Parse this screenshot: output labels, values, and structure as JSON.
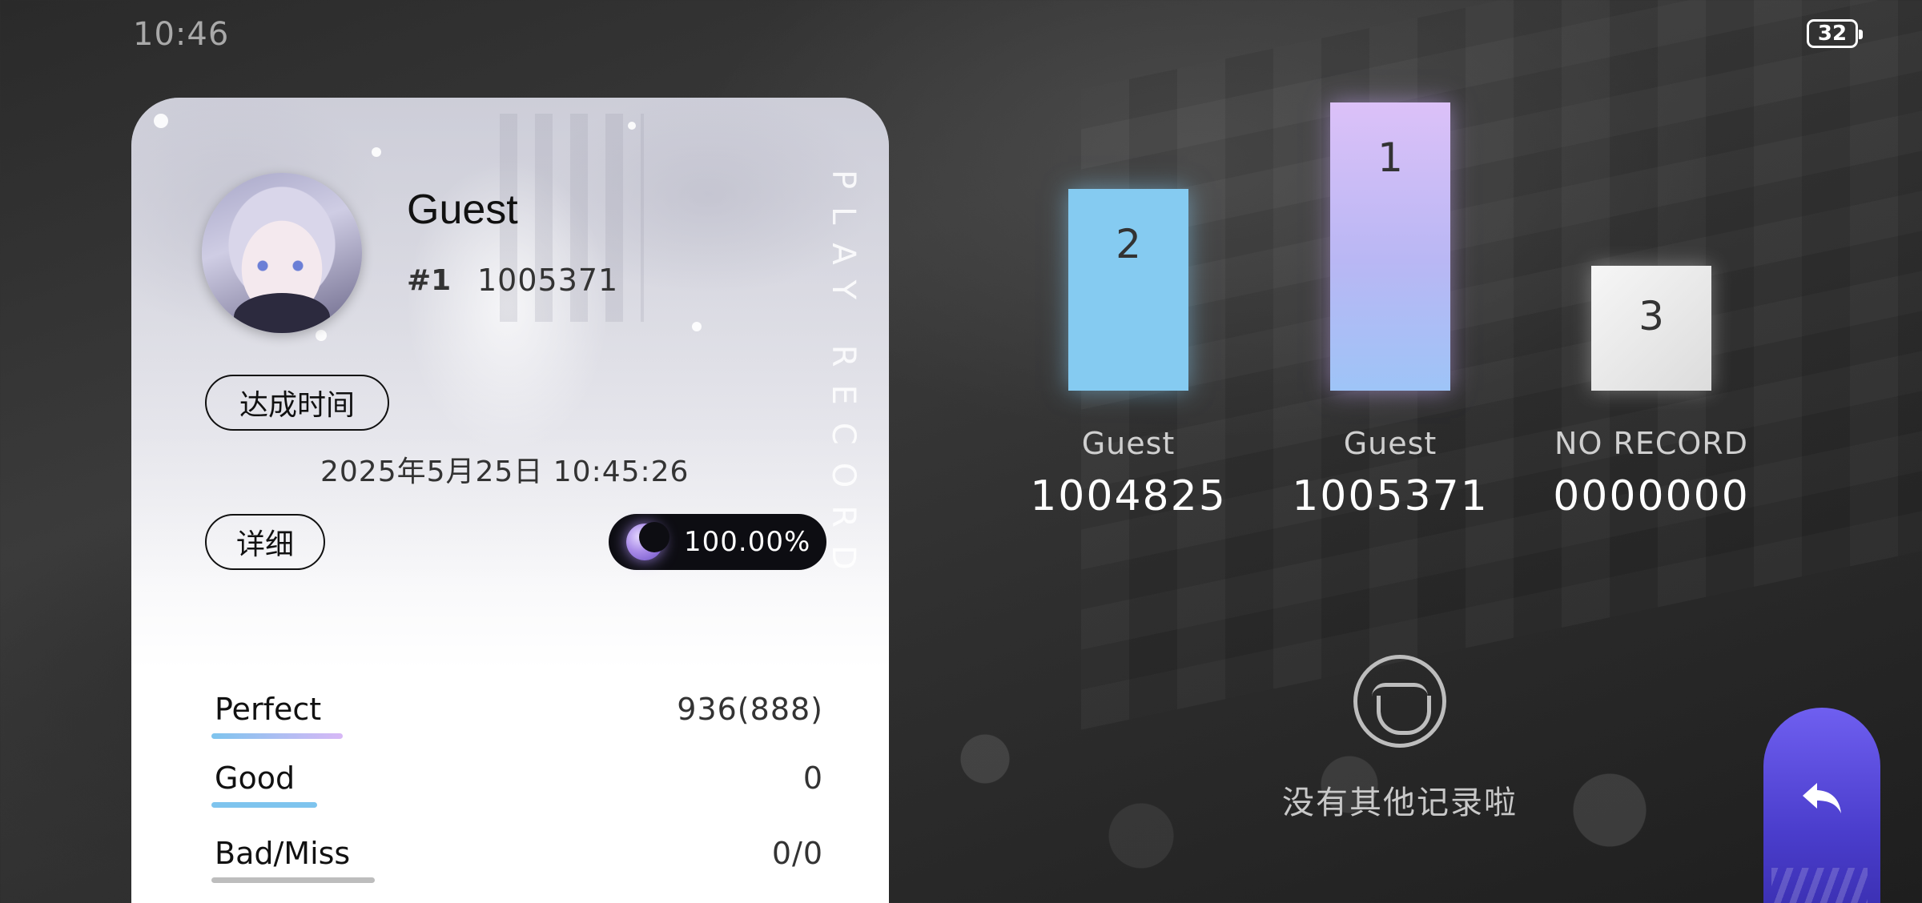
{
  "status": {
    "time": "10:46",
    "battery": "32"
  },
  "card": {
    "player_name": "Guest",
    "rank": "#1",
    "score": "1005371",
    "vertical_text": "PLAY RECORD",
    "achieve_label": "达成时间",
    "achieve_time": "2025年5月25日 10:45:26",
    "detail_label": "详细",
    "accuracy": "100.00%",
    "stats": [
      {
        "label": "Perfect",
        "value": "936(888)"
      },
      {
        "label": "Good",
        "value": "0"
      },
      {
        "label": "Bad/Miss",
        "value": "0/0"
      }
    ]
  },
  "leaderboard": [
    {
      "rank": "2",
      "name": "Guest",
      "score": "1004825"
    },
    {
      "rank": "1",
      "name": "Guest",
      "score": "1005371"
    },
    {
      "rank": "3",
      "name": "NO RECORD",
      "score": "0000000"
    }
  ],
  "empty_state": {
    "icon": "crying-face-icon",
    "text": "没有其他记录啦"
  },
  "back_button": {
    "icon": "back-arrow-icon"
  },
  "colors": {
    "perfect_bar": "#d8b8f6",
    "good_bar": "#7ec4ee",
    "bad_bar": "#bdbdbd",
    "podium_1": "#dcc1f8",
    "podium_2": "#85cbf1",
    "podium_3": "#f0f0f0",
    "back_button": "#5a4be0"
  }
}
